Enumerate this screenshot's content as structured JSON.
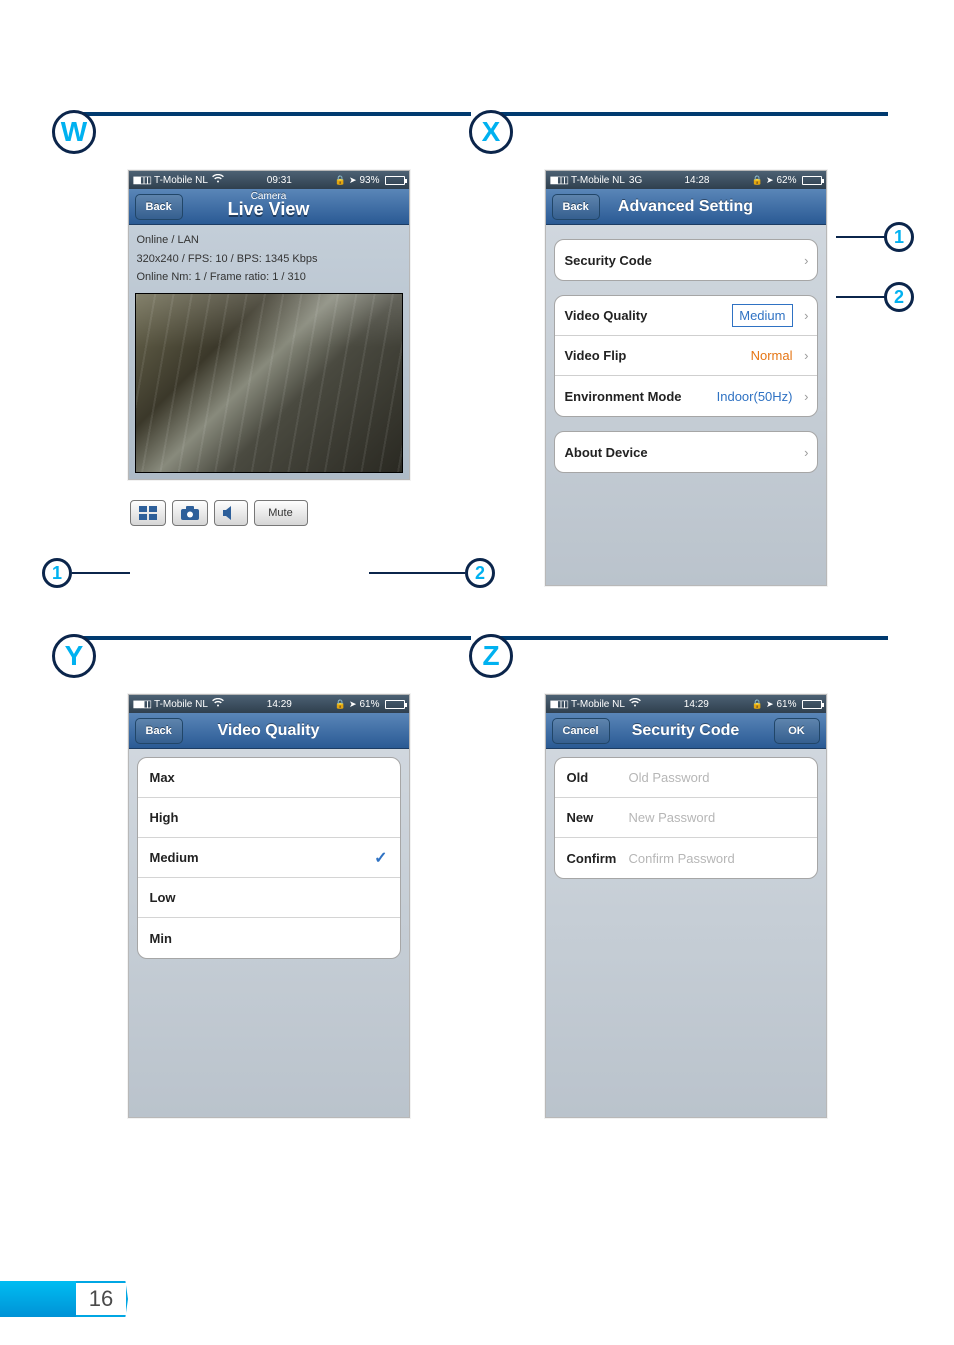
{
  "page_number": "16",
  "sections": [
    "W",
    "X",
    "Y",
    "Z"
  ],
  "W": {
    "status": {
      "carrier": "T-Mobile NL",
      "net_icon": "wifi",
      "time": "09:31",
      "battery_pct": "93%"
    },
    "nav": {
      "sup": "Camera",
      "title": "Live View",
      "back": "Back"
    },
    "info": {
      "line1": "Online / LAN",
      "line2": "320x240 / FPS: 10 / BPS: 1345 Kbps",
      "line3": "Online Nm: 1 / Frame ratio: 1 / 310"
    },
    "toolbar": {
      "mute": "Mute"
    },
    "callouts": [
      "1",
      "2"
    ]
  },
  "X": {
    "status": {
      "carrier": "T-Mobile NL",
      "net": "3G",
      "time": "14:28",
      "battery_pct": "62%"
    },
    "nav": {
      "title": "Advanced Setting",
      "back": "Back"
    },
    "rows": {
      "security_code": "Security Code",
      "video_quality": "Video Quality",
      "video_quality_val": "Medium",
      "video_flip": "Video Flip",
      "video_flip_val": "Normal",
      "env_mode": "Environment Mode",
      "env_mode_val": "Indoor(50Hz)",
      "about": "About Device"
    },
    "callouts": [
      "1",
      "2"
    ]
  },
  "Y": {
    "status": {
      "carrier": "T-Mobile NL",
      "net_icon": "wifi",
      "time": "14:29",
      "battery_pct": "61%"
    },
    "nav": {
      "title": "Video Quality",
      "back": "Back"
    },
    "options": [
      "Max",
      "High",
      "Medium",
      "Low",
      "Min"
    ],
    "selected_index": 2
  },
  "Z": {
    "status": {
      "carrier": "T-Mobile NL",
      "net_icon": "wifi",
      "time": "14:29",
      "battery_pct": "61%"
    },
    "nav": {
      "title": "Security Code",
      "left": "Cancel",
      "right": "OK"
    },
    "fields": {
      "old_label": "Old",
      "old_ph": "Old Password",
      "new_label": "New",
      "new_ph": "New Password",
      "confirm_label": "Confirm",
      "confirm_ph": "Confirm Password"
    }
  }
}
